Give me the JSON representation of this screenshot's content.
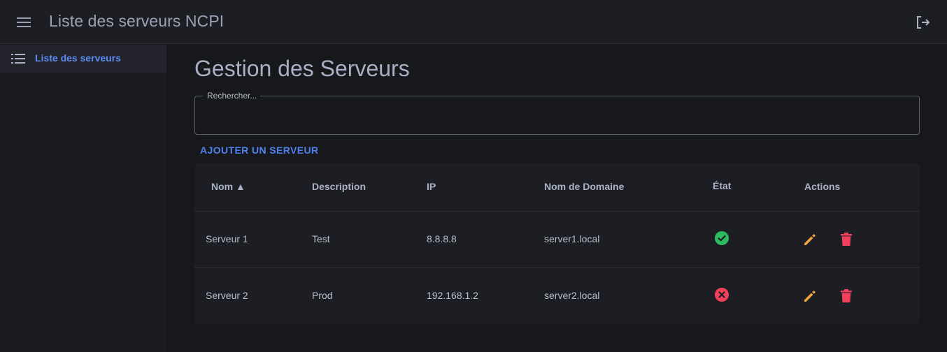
{
  "appbar": {
    "title": "Liste des serveurs NCPI"
  },
  "sidebar": {
    "items": [
      {
        "label": "Liste des serveurs"
      }
    ]
  },
  "main": {
    "title": "Gestion des Serveurs",
    "search": {
      "label": "Rechercher...",
      "value": ""
    },
    "add_button": "AJOUTER UN SERVEUR"
  },
  "table": {
    "headers": {
      "name": "Nom ▲",
      "description": "Description",
      "ip": "IP",
      "domain": "Nom de Domaine",
      "state": "État",
      "actions": "Actions"
    },
    "rows": [
      {
        "name": "Serveur 1",
        "description": "Test",
        "ip": "8.8.8.8",
        "domain": "server1.local",
        "state": "ok"
      },
      {
        "name": "Serveur 2",
        "description": "Prod",
        "ip": "192.168.1.2",
        "domain": "server2.local",
        "state": "error"
      }
    ]
  },
  "colors": {
    "accent": "#4f82ee",
    "state_ok": "#2dbd5f",
    "state_error": "#f0405c",
    "edit": "#f3a53a",
    "delete": "#f0405c"
  }
}
